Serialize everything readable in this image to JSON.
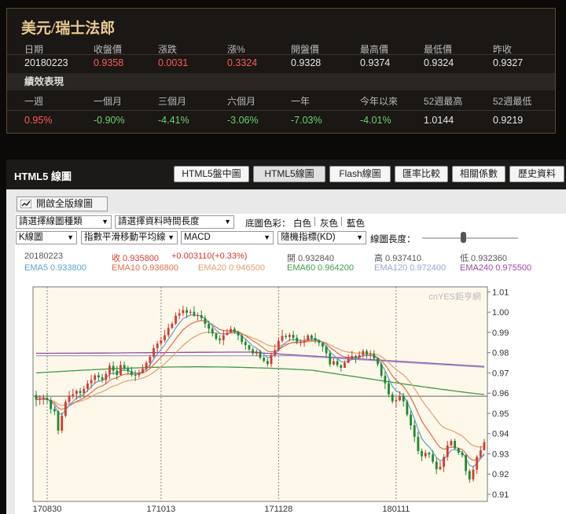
{
  "summary": {
    "title": "美元/瑞士法郎",
    "headers": [
      "日期",
      "收盤價",
      "漲跌",
      "漲%",
      "開盤價",
      "最高價",
      "最低價",
      "昨收"
    ],
    "values": [
      "20180223",
      "0.9358",
      "0.0031",
      "0.3324",
      "0.9328",
      "0.9374",
      "0.9324",
      "0.9327"
    ],
    "perf_title": "績效表現",
    "perf_headers": [
      "一週",
      "一個月",
      "三個月",
      "六個月",
      "一年",
      "今年以來",
      "52週最高",
      "52週最低"
    ],
    "perf_values": [
      "0.95%",
      "-0.90%",
      "-4.41%",
      "-3.06%",
      "-7.03%",
      "-4.01%",
      "1.0144",
      "0.9219"
    ]
  },
  "panel": {
    "title": "HTML5 線圖",
    "tabs": [
      "HTML5盤中圖",
      "HTML5線圖",
      "Flash線圖",
      "匯率比較",
      "相關係數",
      "歷史資料"
    ],
    "active_tab": "HTML5線圖",
    "full_button": "開啟全版線圖"
  },
  "controls": {
    "chart_type": "請選擇線圖種類",
    "time_length": "請選擇資料時間長度",
    "bg_label": "底圖色彩：",
    "bg_white": "白色",
    "bg_gray": "灰色",
    "bg_blue": "藍色",
    "sep": "|",
    "kline": "K線圖",
    "ma": "指數平滑移動平均線",
    "macd": "MACD",
    "kd": "隨機指標(KD)",
    "scale_label": "線圖長度：",
    "arrow": "▼"
  },
  "info": {
    "date": "20180223",
    "close": "收 0.935800",
    "change": "+0.003110(+0.33%)",
    "open": "開 0.932840",
    "high": "高 0.937410",
    "low": "低 0.932360",
    "ema5": "EMA5 0.933800",
    "ema10": "EMA10 0.936800",
    "ema20": "EMA20 0.946500",
    "ema60": "EMA60 0.964200",
    "ema120": "EMA120 0.972400",
    "ema240": "EMA240 0.975500",
    "watermark": "cnYES鉅亨網"
  },
  "colors": {
    "up": "#d43a2f",
    "down": "#1f8a2f",
    "ema5": "#5a9fd4",
    "ema10": "#e06c4a",
    "ema20": "#e0a070",
    "ema60": "#3e9a4a",
    "ema120": "#9aa3d0",
    "ema240": "#9a4aa0"
  },
  "chart_data": {
    "type": "candlestick",
    "y_ticks": [
      "1.01",
      "1.00",
      "0.99",
      "0.98",
      "0.97",
      "0.96",
      "0.95",
      "0.94",
      "0.93",
      "0.92",
      "0.91"
    ],
    "ylim": [
      0.9065,
      1.0125
    ],
    "x_tick_labels": [
      "170830",
      "171013",
      "171128",
      "180111"
    ],
    "x_tick_index": [
      3,
      34,
      66,
      98
    ],
    "reference_level": 0.9585,
    "candles": [
      [
        0.959,
        0.9568,
        0.9612,
        0.9535
      ],
      [
        0.9568,
        0.9572,
        0.959,
        0.9541
      ],
      [
        0.9572,
        0.9576,
        0.9593,
        0.9543
      ],
      [
        0.9576,
        0.9566,
        0.9601,
        0.9547
      ],
      [
        0.9566,
        0.9521,
        0.958,
        0.9498
      ],
      [
        0.9521,
        0.951,
        0.9536,
        0.9491
      ],
      [
        0.951,
        0.9415,
        0.9517,
        0.9397
      ],
      [
        0.9415,
        0.9488,
        0.9503,
        0.9403
      ],
      [
        0.9488,
        0.9557,
        0.9569,
        0.9479
      ],
      [
        0.9557,
        0.9587,
        0.9611,
        0.9548
      ],
      [
        0.9587,
        0.9595,
        0.9621,
        0.9571
      ],
      [
        0.9595,
        0.9611,
        0.9618,
        0.9569
      ],
      [
        0.9611,
        0.96,
        0.9626,
        0.9574
      ],
      [
        0.96,
        0.9621,
        0.9637,
        0.958
      ],
      [
        0.9621,
        0.9648,
        0.9663,
        0.9606
      ],
      [
        0.9648,
        0.9665,
        0.969,
        0.9625
      ],
      [
        0.9665,
        0.9688,
        0.9697,
        0.9646
      ],
      [
        0.9688,
        0.9678,
        0.9704,
        0.9661
      ],
      [
        0.9678,
        0.9666,
        0.9695,
        0.9652
      ],
      [
        0.9666,
        0.9695,
        0.971,
        0.9646
      ],
      [
        0.9695,
        0.9735,
        0.975,
        0.9669
      ],
      [
        0.9735,
        0.9711,
        0.9757,
        0.969
      ],
      [
        0.9711,
        0.969,
        0.9735,
        0.9666
      ],
      [
        0.969,
        0.9739,
        0.9759,
        0.9685
      ],
      [
        0.9739,
        0.9721,
        0.9755,
        0.9711
      ],
      [
        0.9721,
        0.9708,
        0.9736,
        0.9691
      ],
      [
        0.9708,
        0.969,
        0.973,
        0.9681
      ],
      [
        0.969,
        0.9689,
        0.9712,
        0.966
      ],
      [
        0.9689,
        0.97,
        0.9717,
        0.9676
      ],
      [
        0.97,
        0.972,
        0.9742,
        0.9697
      ],
      [
        0.972,
        0.975,
        0.976,
        0.9709
      ],
      [
        0.975,
        0.978,
        0.979,
        0.9727
      ],
      [
        0.978,
        0.9822,
        0.9839,
        0.9773
      ],
      [
        0.9822,
        0.9845,
        0.9858,
        0.9797
      ],
      [
        0.9845,
        0.9861,
        0.9879,
        0.9833
      ],
      [
        0.9861,
        0.9886,
        0.9913,
        0.9851
      ],
      [
        0.9886,
        0.9922,
        0.9943,
        0.9876
      ],
      [
        0.9922,
        0.9943,
        0.9953,
        0.9917
      ],
      [
        0.9943,
        0.9983,
        0.9998,
        0.9936
      ],
      [
        0.9983,
        0.9995,
        1.0016,
        0.9965
      ],
      [
        0.9995,
        1.001,
        1.0032,
        0.9981
      ],
      [
        1.001,
        0.9997,
        1.0026,
        0.9971
      ],
      [
        0.9997,
        1.0002,
        1.0014,
        0.9984
      ],
      [
        1.0002,
        0.9983,
        1.0029,
        0.9976
      ],
      [
        0.9983,
        0.9985,
        0.9999,
        0.996
      ],
      [
        0.9985,
        0.9971,
        1.0009,
        0.9958
      ],
      [
        0.9971,
        0.9942,
        0.9984,
        0.9923
      ],
      [
        0.9942,
        0.9919,
        0.9958,
        0.9895
      ],
      [
        0.9919,
        0.9894,
        0.9929,
        0.988
      ],
      [
        0.9894,
        0.9869,
        0.99,
        0.986
      ],
      [
        0.9869,
        0.9862,
        0.9887,
        0.9842
      ],
      [
        0.9862,
        0.9886,
        0.9912,
        0.9837
      ],
      [
        0.9886,
        0.9898,
        0.9917,
        0.9888
      ],
      [
        0.9898,
        0.9917,
        0.9932,
        0.9904
      ],
      [
        0.9917,
        0.9903,
        0.9927,
        0.9893
      ],
      [
        0.9903,
        0.9885,
        0.9908,
        0.9861
      ],
      [
        0.9885,
        0.9853,
        0.9894,
        0.984
      ],
      [
        0.9853,
        0.9837,
        0.9865,
        0.9814
      ],
      [
        0.9837,
        0.9816,
        0.984,
        0.9808
      ],
      [
        0.9816,
        0.9796,
        0.9825,
        0.9787
      ],
      [
        0.9796,
        0.9806,
        0.9816,
        0.9783
      ],
      [
        0.9806,
        0.9775,
        0.9815,
        0.9766
      ],
      [
        0.9775,
        0.9759,
        0.9782,
        0.9751
      ],
      [
        0.9759,
        0.9744,
        0.9771,
        0.9731
      ],
      [
        0.9744,
        0.9788,
        0.9798,
        0.9728
      ],
      [
        0.9788,
        0.9812,
        0.9841,
        0.9777
      ],
      [
        0.9812,
        0.9858,
        0.9876,
        0.9806
      ],
      [
        0.9858,
        0.9883,
        0.9913,
        0.985
      ],
      [
        0.9883,
        0.9877,
        0.9895,
        0.9867
      ],
      [
        0.9877,
        0.9888,
        0.9898,
        0.9856
      ],
      [
        0.9888,
        0.9873,
        0.9908,
        0.9856
      ],
      [
        0.9873,
        0.9854,
        0.9889,
        0.9841
      ],
      [
        0.9854,
        0.9855,
        0.9866,
        0.9832
      ],
      [
        0.9855,
        0.9859,
        0.9883,
        0.9829
      ],
      [
        0.9859,
        0.9885,
        0.9893,
        0.9867
      ],
      [
        0.9885,
        0.9872,
        0.9891,
        0.9858
      ],
      [
        0.9872,
        0.9861,
        0.9897,
        0.9846
      ],
      [
        0.9861,
        0.9848,
        0.9866,
        0.9832
      ],
      [
        0.9848,
        0.983,
        0.9849,
        0.9804
      ],
      [
        0.983,
        0.9797,
        0.9836,
        0.9776
      ],
      [
        0.9797,
        0.9742,
        0.9811,
        0.973
      ],
      [
        0.9742,
        0.9758,
        0.9771,
        0.9737
      ],
      [
        0.9758,
        0.9738,
        0.9769,
        0.9728
      ],
      [
        0.9738,
        0.9725,
        0.9742,
        0.9706
      ],
      [
        0.9725,
        0.9749,
        0.9762,
        0.9729
      ],
      [
        0.9749,
        0.9768,
        0.9791,
        0.9756
      ],
      [
        0.9768,
        0.9783,
        0.9809,
        0.9766
      ],
      [
        0.9783,
        0.9774,
        0.9791,
        0.9748
      ],
      [
        0.9774,
        0.9788,
        0.9807,
        0.9774
      ],
      [
        0.9788,
        0.9808,
        0.9818,
        0.9773
      ],
      [
        0.9808,
        0.9791,
        0.9817,
        0.9773
      ],
      [
        0.9791,
        0.9793,
        0.9811,
        0.9765
      ],
      [
        0.9793,
        0.9771,
        0.9812,
        0.9762
      ],
      [
        0.9771,
        0.9743,
        0.9775,
        0.9733
      ],
      [
        0.9743,
        0.9686,
        0.9752,
        0.9676
      ],
      [
        0.9686,
        0.9649,
        0.9708,
        0.962
      ],
      [
        0.9649,
        0.9594,
        0.9664,
        0.958
      ],
      [
        0.9594,
        0.9559,
        0.9606,
        0.9548
      ],
      [
        0.9559,
        0.9565,
        0.9578,
        0.9529
      ],
      [
        0.9565,
        0.9585,
        0.9609,
        0.9559
      ],
      [
        0.9585,
        0.9559,
        0.9601,
        0.9534
      ],
      [
        0.9559,
        0.9494,
        0.9568,
        0.9485
      ],
      [
        0.9494,
        0.9441,
        0.9512,
        0.9419
      ],
      [
        0.9441,
        0.9384,
        0.9465,
        0.9358
      ],
      [
        0.9384,
        0.9314,
        0.9409,
        0.9298
      ],
      [
        0.9314,
        0.9288,
        0.9326,
        0.9264
      ],
      [
        0.9288,
        0.9305,
        0.932,
        0.9277
      ],
      [
        0.9305,
        0.9297,
        0.9311,
        0.928
      ],
      [
        0.9297,
        0.9261,
        0.9317,
        0.9252
      ],
      [
        0.9261,
        0.9224,
        0.928,
        0.92
      ],
      [
        0.9224,
        0.9236,
        0.9262,
        0.9218
      ],
      [
        0.9236,
        0.9285,
        0.9298,
        0.921
      ],
      [
        0.9285,
        0.9342,
        0.9364,
        0.9266
      ],
      [
        0.9342,
        0.9364,
        0.9373,
        0.9338
      ],
      [
        0.9364,
        0.9327,
        0.9375,
        0.9321
      ],
      [
        0.9327,
        0.9306,
        0.9331,
        0.9295
      ],
      [
        0.9306,
        0.9293,
        0.9314,
        0.9282
      ],
      [
        0.9293,
        0.9215,
        0.9298,
        0.9195
      ],
      [
        0.9215,
        0.9174,
        0.9225,
        0.9157
      ],
      [
        0.9174,
        0.9222,
        0.9241,
        0.9163
      ],
      [
        0.9222,
        0.9285,
        0.9294,
        0.9201
      ],
      [
        0.9285,
        0.9318,
        0.9338,
        0.928
      ],
      [
        0.9318,
        0.9358,
        0.9374,
        0.9324
      ]
    ],
    "ema5": [
      0.9579,
      0.9577,
      0.9576,
      0.9573,
      0.9556,
      0.9541,
      0.9499,
      0.9495,
      0.9516,
      0.954,
      0.9558,
      0.9576,
      0.9584,
      0.9596,
      0.9613,
      0.9631,
      0.965,
      0.9659,
      0.9662,
      0.9673,
      0.9693,
      0.9699,
      0.9696,
      0.9711,
      0.9714,
      0.9712,
      0.9705,
      0.9699,
      0.9699,
      0.9706,
      0.9721,
      0.974,
      0.9768,
      0.9793,
      0.9816,
      0.9839,
      0.9867,
      0.9892,
      0.9922,
      0.9946,
      0.9968,
      0.9978,
      0.9986,
      0.9985,
      0.9985,
      0.998,
      0.9968,
      0.9951,
      0.9932,
      0.9911,
      0.9895,
      0.9892,
      0.9894,
      0.9902,
      0.9902,
      0.9896,
      0.9882,
      0.9867,
      0.985,
      0.9832,
      0.9823,
      0.9807,
      0.9791,
      0.9775,
      0.978,
      0.979,
      0.9813,
      0.9836,
      0.985,
      0.9863,
      0.9866,
      0.9862,
      0.986,
      0.986,
      0.9868,
      0.9869,
      0.9867,
      0.986,
      0.985,
      0.9832,
      0.9802,
      0.9788,
      0.9771,
      0.9756,
      0.9753,
      0.9758,
      0.9766,
      0.9769,
      0.9775,
      0.9786,
      0.9788,
      0.9789,
      0.9783,
      0.977,
      0.9742,
      0.9711,
      0.9672,
      0.9634,
      0.9611,
      0.9602,
      0.9588,
      0.9556,
      0.9518,
      0.9473,
      0.942,
      0.9376,
      0.9352,
      0.9334,
      0.931,
      0.9281,
      0.9266,
      0.9272,
      0.9296,
      0.9318,
      0.9321,
      0.9316,
      0.9309,
      0.9278,
      0.9243,
      0.9236,
      0.9253,
      0.9275,
      0.9302
    ]
  }
}
